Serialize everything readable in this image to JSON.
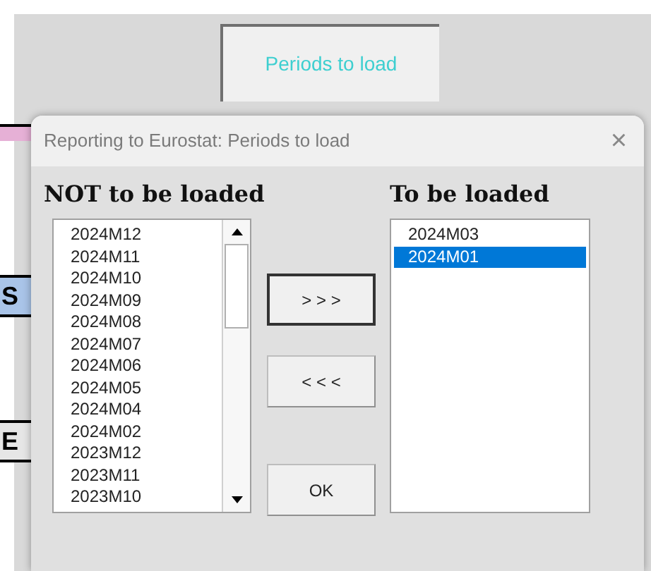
{
  "sheet_button": {
    "label": "Periods to load"
  },
  "sheet_fragments": [
    {
      "label": "S",
      "kind": "blue"
    },
    {
      "label": "E",
      "kind": "plain"
    }
  ],
  "dialog": {
    "title": "Reporting to Eurostat: Periods to load",
    "close": "×"
  },
  "not_loaded": {
    "heading": "NOT to be loaded",
    "items": [
      {
        "label": "2024M12",
        "selected": false
      },
      {
        "label": "2024M11",
        "selected": false
      },
      {
        "label": "2024M10",
        "selected": false
      },
      {
        "label": "2024M09",
        "selected": false
      },
      {
        "label": "2024M08",
        "selected": false
      },
      {
        "label": "2024M07",
        "selected": false
      },
      {
        "label": "2024M06",
        "selected": false
      },
      {
        "label": "2024M05",
        "selected": false
      },
      {
        "label": "2024M04",
        "selected": false
      },
      {
        "label": "2024M02",
        "selected": false
      },
      {
        "label": "2023M12",
        "selected": false
      },
      {
        "label": "2023M11",
        "selected": false
      },
      {
        "label": "2023M10",
        "selected": false
      }
    ]
  },
  "buttons": [
    {
      "label": "> > >",
      "default": true
    },
    {
      "label": "< < <",
      "default": false
    },
    {
      "label": "OK",
      "default": false
    }
  ],
  "to_load": {
    "heading": "To be loaded",
    "items": [
      {
        "label": "2024M03",
        "selected": false
      },
      {
        "label": "2024M01",
        "selected": true
      }
    ]
  }
}
